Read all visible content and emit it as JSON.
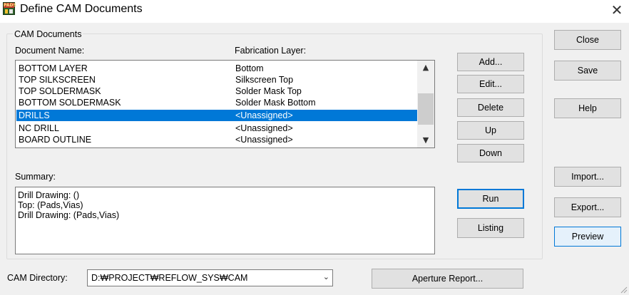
{
  "window": {
    "title": "Define CAM Documents",
    "icon_text": "PADS",
    "close_glyph": "✕"
  },
  "group": {
    "title": "CAM Documents"
  },
  "list": {
    "col1_header": "Document Name:",
    "col2_header": "Fabrication Layer:",
    "rows": [
      {
        "name": "BOTTOM LAYER",
        "layer": "Bottom",
        "selected": false
      },
      {
        "name": "TOP SILKSCREEN",
        "layer": "Silkscreen Top",
        "selected": false
      },
      {
        "name": "TOP SOLDERMASK",
        "layer": "Solder Mask Top",
        "selected": false
      },
      {
        "name": "BOTTOM SOLDERMASK",
        "layer": "Solder Mask Bottom",
        "selected": false
      },
      {
        "name": "DRILLS",
        "layer": "<Unassigned>",
        "selected": true
      },
      {
        "name": "NC DRILL",
        "layer": "<Unassigned>",
        "selected": false
      },
      {
        "name": "BOARD OUTLINE",
        "layer": "<Unassigned>",
        "selected": false
      }
    ],
    "scroll_up_glyph": "▲",
    "scroll_down_glyph": "▼"
  },
  "summary": {
    "label": "Summary:",
    "lines": [
      "Drill Drawing: ()",
      "Top: (Pads,Vias)",
      "Drill Drawing: (Pads,Vias)"
    ]
  },
  "buttons": {
    "add": "Add...",
    "edit": "Edit...",
    "delete": "Delete",
    "up": "Up",
    "down": "Down",
    "run": "Run",
    "listing": "Listing",
    "close": "Close",
    "save": "Save",
    "help": "Help",
    "import": "Import...",
    "export": "Export...",
    "preview": "Preview",
    "aperture_report": "Aperture Report..."
  },
  "cam_directory": {
    "label": "CAM Directory:",
    "value": "D:₩PROJECT₩REFLOW_SYS₩CAM",
    "arrow_glyph": "⌄"
  },
  "colors": {
    "selection": "#0078d7",
    "dialog_bg": "#f0f0f0",
    "default_button_border": "#0078d7"
  }
}
